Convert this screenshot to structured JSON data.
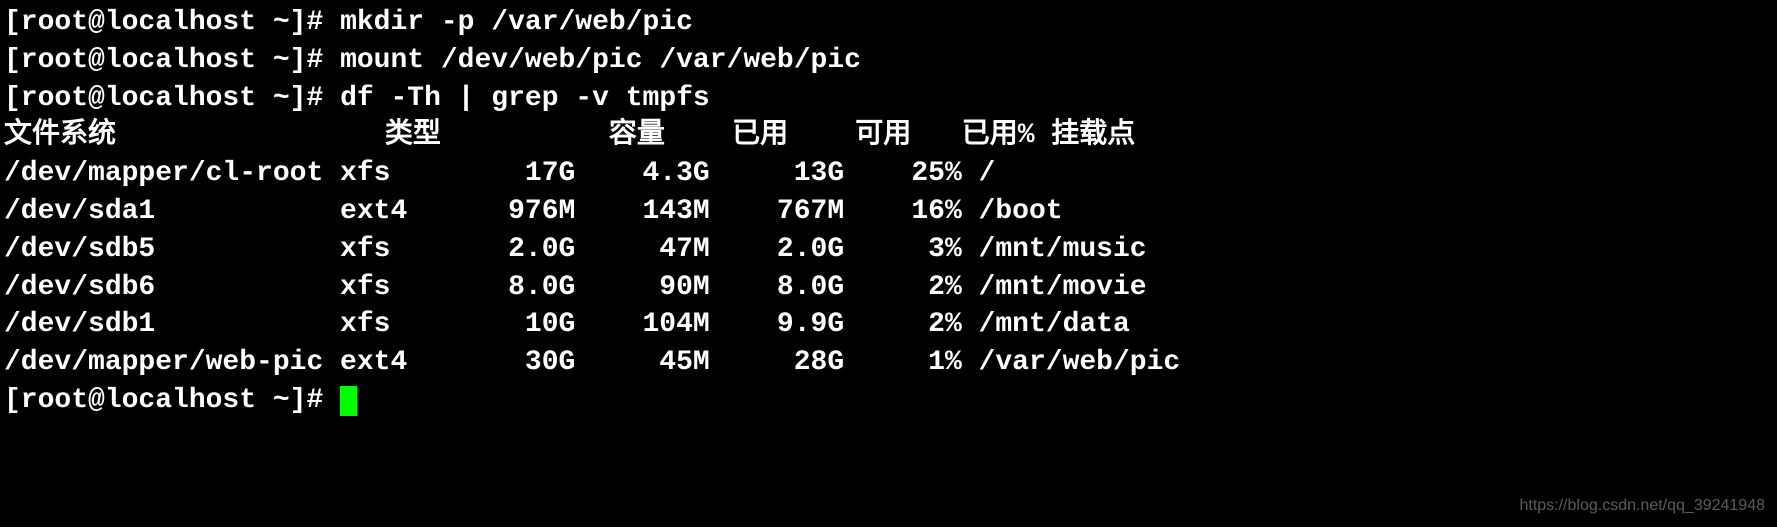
{
  "prompts": {
    "p1": "[root@localhost ~]# ",
    "p2": "[root@localhost ~]# ",
    "p3": "[root@localhost ~]# ",
    "p4": "[root@localhost ~]# "
  },
  "commands": {
    "c1": "mkdir -p /var/web/pic",
    "c2": "mount /dev/web/pic /var/web/pic",
    "c3": "df -Th | grep -v tmpfs"
  },
  "headers": {
    "filesystem": "文件系统",
    "type": "类型",
    "size": "容量",
    "used": "已用",
    "avail": "可用",
    "usepct": "已用%",
    "mount": "挂载点"
  },
  "rows": [
    {
      "fs": "/dev/mapper/cl-root",
      "type": "xfs",
      "size": "17G",
      "used": "4.3G",
      "avail": "13G",
      "usepct": "25%",
      "mount": "/"
    },
    {
      "fs": "/dev/sda1",
      "type": "ext4",
      "size": "976M",
      "used": "143M",
      "avail": "767M",
      "usepct": "16%",
      "mount": "/boot"
    },
    {
      "fs": "/dev/sdb5",
      "type": "xfs",
      "size": "2.0G",
      "used": "47M",
      "avail": "2.0G",
      "usepct": "3%",
      "mount": "/mnt/music"
    },
    {
      "fs": "/dev/sdb6",
      "type": "xfs",
      "size": "8.0G",
      "used": "90M",
      "avail": "8.0G",
      "usepct": "2%",
      "mount": "/mnt/movie"
    },
    {
      "fs": "/dev/sdb1",
      "type": "xfs",
      "size": "10G",
      "used": "104M",
      "avail": "9.9G",
      "usepct": "2%",
      "mount": "/mnt/data"
    },
    {
      "fs": "/dev/mapper/web-pic",
      "type": "ext4",
      "size": "30G",
      "used": "45M",
      "avail": "28G",
      "usepct": "1%",
      "mount": "/var/web/pic"
    }
  ],
  "watermark": "https://blog.csdn.net/qq_39241948",
  "chart_data": {
    "type": "table",
    "title": "df -Th output (tmpfs excluded)",
    "columns": [
      "文件系统",
      "类型",
      "容量",
      "已用",
      "可用",
      "已用%",
      "挂载点"
    ],
    "data": [
      [
        "/dev/mapper/cl-root",
        "xfs",
        "17G",
        "4.3G",
        "13G",
        "25%",
        "/"
      ],
      [
        "/dev/sda1",
        "ext4",
        "976M",
        "143M",
        "767M",
        "16%",
        "/boot"
      ],
      [
        "/dev/sdb5",
        "xfs",
        "2.0G",
        "47M",
        "2.0G",
        "3%",
        "/mnt/music"
      ],
      [
        "/dev/sdb6",
        "xfs",
        "8.0G",
        "90M",
        "8.0G",
        "2%",
        "/mnt/movie"
      ],
      [
        "/dev/sdb1",
        "xfs",
        "10G",
        "104M",
        "9.9G",
        "2%",
        "/mnt/data"
      ],
      [
        "/dev/mapper/web-pic",
        "ext4",
        "30G",
        "45M",
        "28G",
        "1%",
        "/var/web/pic"
      ]
    ]
  }
}
